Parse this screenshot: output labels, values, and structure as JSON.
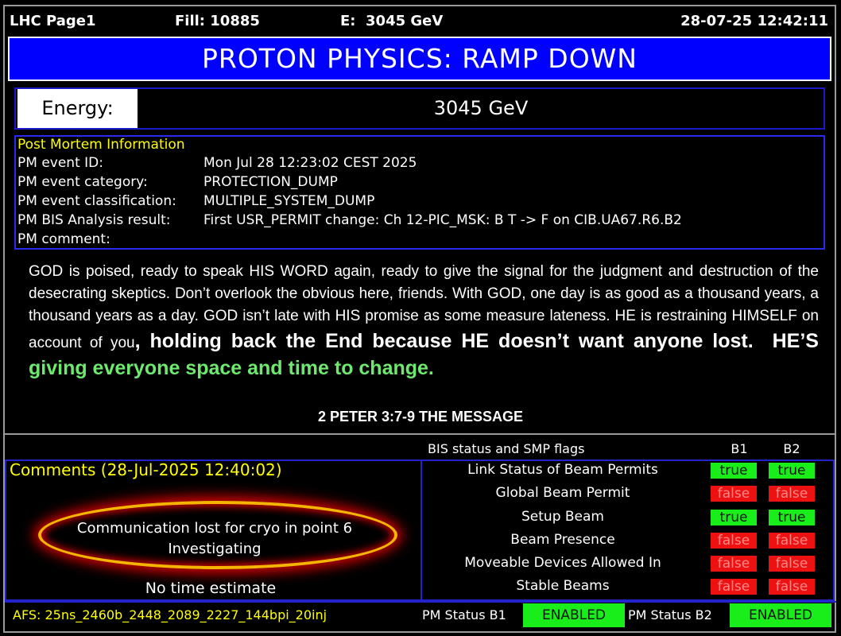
{
  "topbar": {
    "page": "LHC Page1",
    "fill": "Fill: 10885",
    "energy": "E:  3045 GeV",
    "datetime": "28-07-25 12:42:11"
  },
  "mode": "PROTON PHYSICS: RAMP DOWN",
  "energy": {
    "label": "Energy:",
    "value": "3045 GeV"
  },
  "post_mortem": {
    "title": "Post Mortem Information",
    "rows": [
      {
        "key": "PM event ID:",
        "value": "Mon Jul 28 12:23:02 CEST 2025"
      },
      {
        "key": "PM event category:",
        "value": "PROTECTION_DUMP"
      },
      {
        "key": "PM event classification:",
        "value": "MULTIPLE_SYSTEM_DUMP"
      },
      {
        "key": "PM BIS Analysis result:",
        "value": "First USR_PERMIT change: Ch 12-PIC_MSK: B T -> F on CIB.UA67.R6.B2"
      },
      {
        "key": "PM comment:",
        "value": ""
      }
    ]
  },
  "verse": {
    "text_normal": "GOD is poised, ready to speak HIS WORD again, ready to give the signal for the judgment and destruction of the desecrating skeptics.  Don’t overlook the obvious here, friends. With GOD, one day is as good as a thousand years, a thousand years as a day. GOD isn’t late with HIS promise as some measure lateness. HE is restraining HIMSELF on account of you",
    "text_bold": ", holding back the End because HE doesn’t want anyone lost.  HE’S ",
    "text_green": "giving everyone space and time to change.",
    "reference": "2 PETER 3:7-9 THE MESSAGE"
  },
  "comments": {
    "title": "Comments (28-Jul-2025 12:40:02)",
    "line1": "Communication lost for cryo in point 6",
    "line2": "Investigating",
    "line3": "No time estimate"
  },
  "bis": {
    "header": "BIS status and SMP flags",
    "col_b1": "B1",
    "col_b2": "B2",
    "flags": [
      {
        "label": "Link Status of Beam Permits",
        "b1": "true",
        "b2": "true"
      },
      {
        "label": "Global Beam Permit",
        "b1": "false",
        "b2": "false"
      },
      {
        "label": "Setup Beam",
        "b1": "true",
        "b2": "true"
      },
      {
        "label": "Beam Presence",
        "b1": "false",
        "b2": "false"
      },
      {
        "label": "Moveable Devices Allowed In",
        "b1": "false",
        "b2": "false"
      },
      {
        "label": "Stable Beams",
        "b1": "false",
        "b2": "false"
      }
    ]
  },
  "footer": {
    "afs": "AFS: 25ns_2460b_2448_2089_2227_144bpi_20inj",
    "pm_b1_label": "PM Status B1",
    "pm_b1_value": "ENABLED",
    "pm_b2_label": "PM Status B2",
    "pm_b2_value": "ENABLED"
  },
  "colors": {
    "banner": "#0000ff",
    "true_flag": "#1aee1a",
    "false_flag": "#ee1111",
    "yellow_text": "#ffff00",
    "highlight_green": "#6ee86e"
  }
}
